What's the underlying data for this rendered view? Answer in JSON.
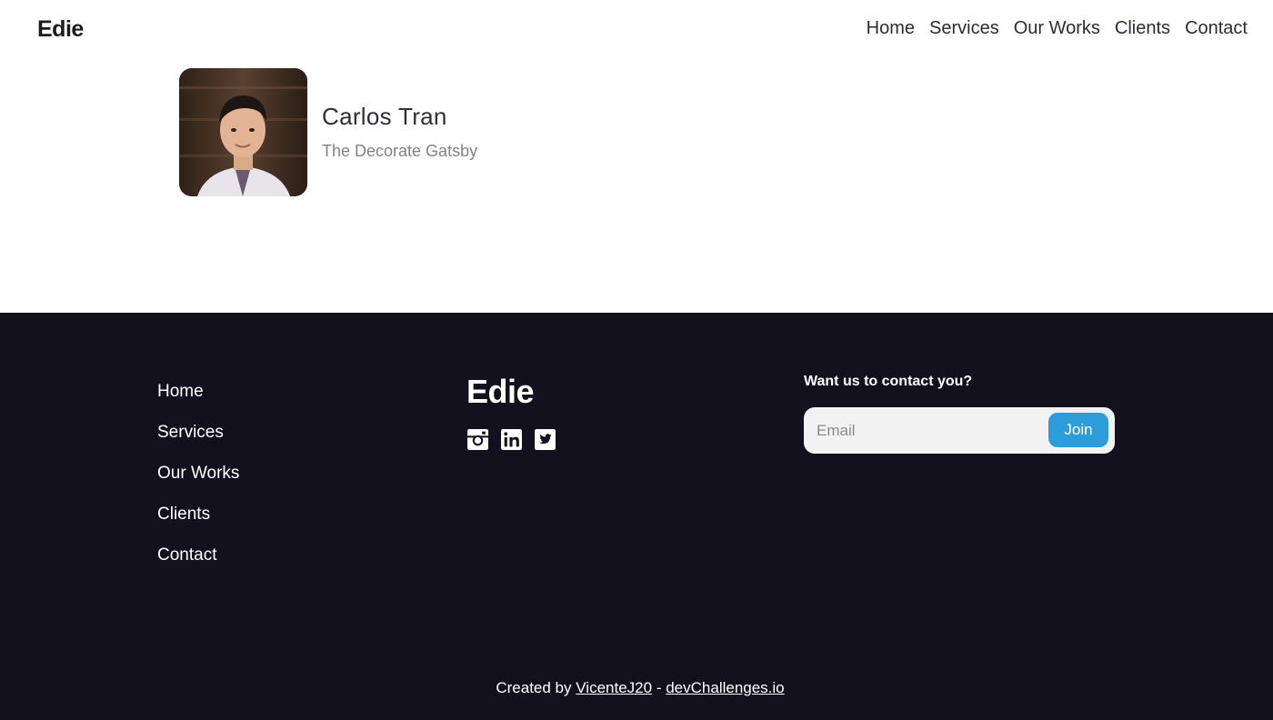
{
  "header": {
    "brand": "Edie",
    "nav": [
      "Home",
      "Services",
      "Our Works",
      "Clients",
      "Contact"
    ]
  },
  "profile": {
    "name": "Carlos Tran",
    "role": "The Decorate Gatsby"
  },
  "footer": {
    "nav": [
      "Home",
      "Services",
      "Our Works",
      "Clients",
      "Contact"
    ],
    "brand": "Edie",
    "social_icons": [
      "instagram-icon",
      "linkedin-icon",
      "twitter-icon"
    ],
    "contact_title": "Want us to contact you?",
    "email_placeholder": "Email",
    "join_label": "Join",
    "credits": {
      "prefix": "Created by",
      "author": "VicenteJ20",
      "separator": "-",
      "site": "devChallenges.io"
    }
  },
  "colors": {
    "footer_bg": "#14111f",
    "accent": "#2d9cdb",
    "muted_text": "#828282"
  }
}
